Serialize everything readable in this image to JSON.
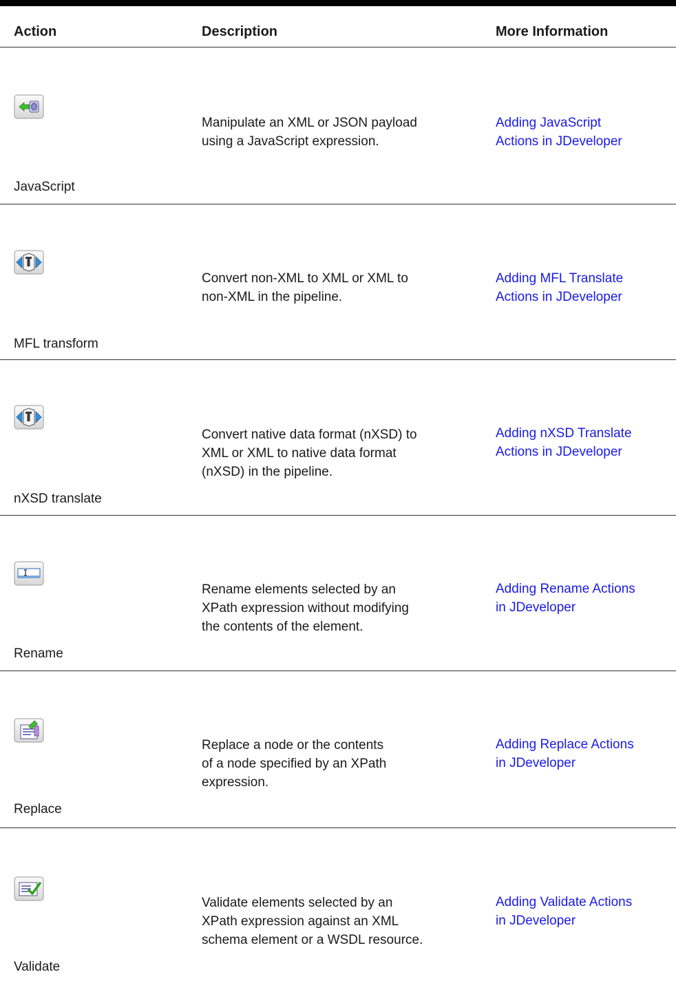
{
  "table": {
    "headers": {
      "action": "Action",
      "description": "Description",
      "more_information": "More Information"
    },
    "rows": [
      {
        "action": "JavaScript",
        "icon": "javascript-action-icon",
        "description": [
          "Manipulate an XML or JSON payload",
          "using a JavaScript expression."
        ],
        "link": [
          "Adding JavaScript",
          "Actions in JDeveloper"
        ]
      },
      {
        "action": "MFL transform",
        "icon": "mfl-transform-icon",
        "description": [
          "Convert non-XML to XML or XML to",
          "non-XML in the pipeline."
        ],
        "link": [
          "Adding MFL Translate",
          "Actions in JDeveloper"
        ]
      },
      {
        "action": "nXSD translate",
        "icon": "nxsd-translate-icon",
        "description": [
          "Convert native data format (nXSD) to",
          "XML or XML to native data format",
          "(nXSD) in the pipeline."
        ],
        "link": [
          "Adding nXSD Translate",
          "Actions in JDeveloper"
        ]
      },
      {
        "action": "Rename",
        "icon": "rename-action-icon",
        "description": [
          "Rename elements selected by an",
          "XPath expression without modifying",
          "the contents of the element."
        ],
        "link": [
          "Adding Rename Actions",
          "in JDeveloper"
        ]
      },
      {
        "action": "Replace",
        "icon": "replace-action-icon",
        "description": [
          "Replace a node or the contents",
          "of a node specified by an XPath",
          "expression."
        ],
        "link": [
          "Adding Replace Actions",
          "in JDeveloper"
        ]
      },
      {
        "action": "Validate",
        "icon": "validate-action-icon",
        "description": [
          "Validate elements selected by an",
          "XPath expression against an XML",
          "schema element or a WSDL resource."
        ],
        "link": [
          "Adding Validate Actions",
          "in JDeveloper"
        ]
      }
    ]
  },
  "colors": {
    "link": "#1a1ae6",
    "text": "#1a1a1a",
    "rule": "#333333"
  }
}
